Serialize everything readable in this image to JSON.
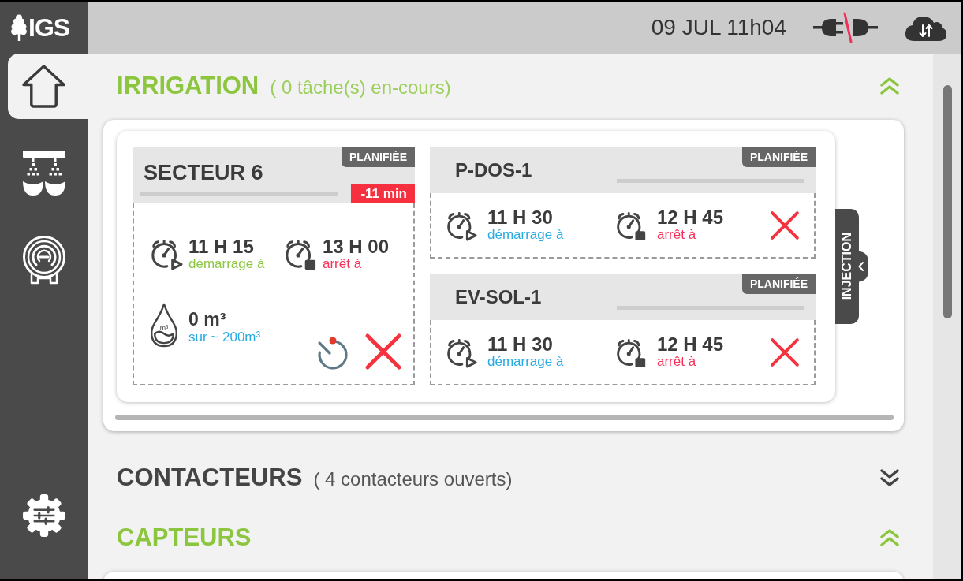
{
  "header": {
    "logo": "IGS",
    "datetime": "09 JUL 11h04",
    "connected": false
  },
  "sidebar": {
    "items": [
      {
        "kind": "home",
        "selected": true
      },
      {
        "kind": "irrigation",
        "selected": false
      },
      {
        "kind": "reel",
        "selected": false
      },
      {
        "kind": "settings",
        "selected": false
      }
    ]
  },
  "sections": [
    {
      "title": "IRRIGATION",
      "subtitle": "( 0 tâche(s) en-cours)",
      "expanded": true,
      "tasks": [
        {
          "kind": "sector",
          "name": "SECTEUR 6",
          "status": "PLANIFIÉE",
          "level": 0,
          "delay": "-11 min",
          "start": {
            "time": "11 H 15",
            "label": "démarrage à"
          },
          "stop": {
            "time": "13 H 00",
            "label": "arrêt à"
          },
          "volume": {
            "icon_label": "m³",
            "value": "0 m³",
            "target": "sur ~ 200m³"
          }
        },
        {
          "kind": "equipment",
          "name": "P-DOS-1",
          "status": "PLANIFIÉE",
          "level": 0,
          "start": {
            "time": "11 H 30",
            "label": "démarrage à"
          },
          "stop": {
            "time": "12 H 45",
            "label": "arrêt à"
          }
        },
        {
          "kind": "equipment",
          "name": "EV-SOL-1",
          "status": "PLANIFIÉE",
          "level": 0,
          "start": {
            "time": "11 H 30",
            "label": "démarrage à"
          },
          "stop": {
            "time": "12 H 45",
            "label": "arrêt à"
          }
        }
      ],
      "side_tab": "INJECTION"
    },
    {
      "title": "CONTACTEURS",
      "subtitle": "( 4 contacteurs ouverts)",
      "expanded": false
    },
    {
      "title": "CAPTEURS",
      "expanded": true
    }
  ]
}
